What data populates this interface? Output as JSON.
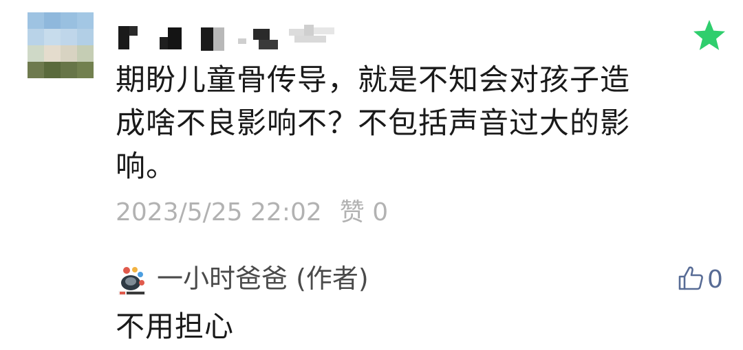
{
  "comment": {
    "text": "期盼儿童骨传导，就是不知会对孩子造成啥不良影响不？不包括声音过大的影响。",
    "timestamp": "2023/5/25 22:02",
    "like_label": "赞",
    "like_count": "0",
    "featured_icon": "star-icon",
    "accent_color": "#2fce6d"
  },
  "reply": {
    "author": "一小时爸爸 (作者)",
    "text": "不用担心",
    "like_count": "0",
    "like_icon": "thumbs-up-icon",
    "like_color": "#576b95"
  }
}
